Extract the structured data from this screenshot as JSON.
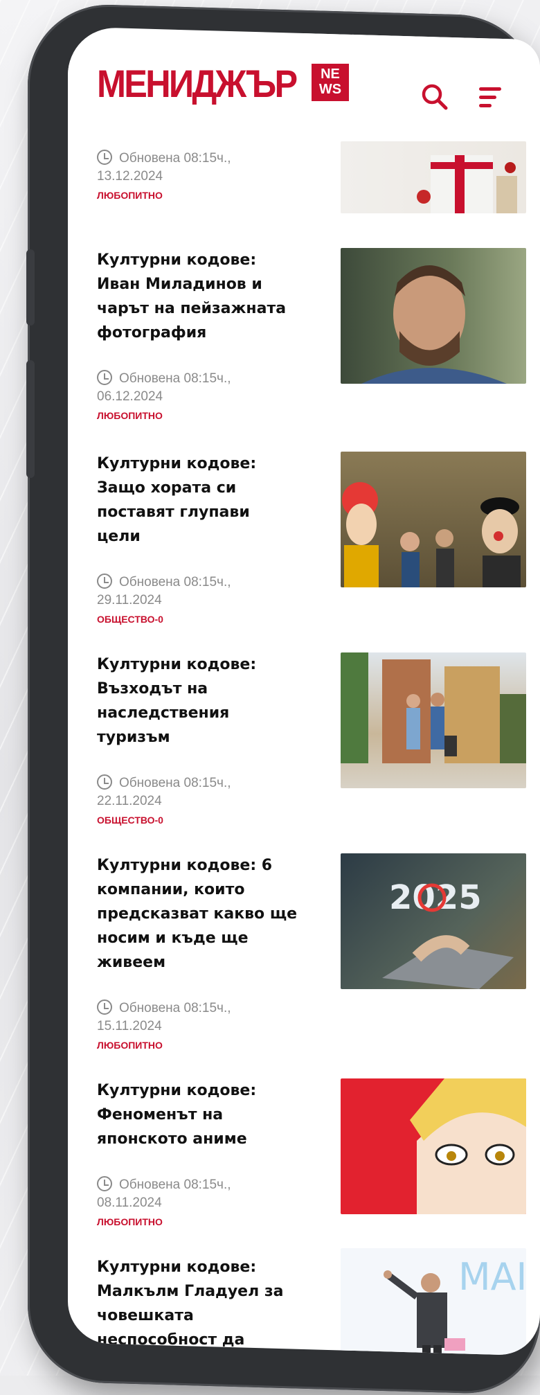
{
  "brand": {
    "logo_main": "МЕНИДЖЪР",
    "logo_badge_top": "NE",
    "logo_badge_bottom": "WS",
    "accent": "#c8102e"
  },
  "header": {
    "search_icon": "search-icon",
    "menu_icon": "hamburger-menu-icon"
  },
  "articles": [
    {
      "title": "",
      "updated": "Обновена 08:15ч.,",
      "date": "13.12.2024",
      "category": "ЛЮБОПИТНО"
    },
    {
      "title": "Културни кодове: Иван Миладинов и чарът на пейзажната фотография",
      "updated": "Обновена 08:15ч.,",
      "date": "06.12.2024",
      "category": "ЛЮБОПИТНО"
    },
    {
      "title": "Културни кодове: Защо хората си поставят глупави цели",
      "updated": "Обновена 08:15ч.,",
      "date": "29.11.2024",
      "category": "ОБЩЕСТВО-0"
    },
    {
      "title": "Културни кодове: Възходът на наследствения туризъм",
      "updated": "Обновена 08:15ч.,",
      "date": "22.11.2024",
      "category": "ОБЩЕСТВО-0"
    },
    {
      "title": "Културни кодове: 6 компании, които предсказват какво ще носим и къде ще живеем",
      "updated": "Обновена 08:15ч.,",
      "date": "15.11.2024",
      "category": "ЛЮБОПИТНО"
    },
    {
      "title": "Културни кодове: Феноменът на японското аниме",
      "updated": "Обновена 08:15ч.,",
      "date": "08.11.2024",
      "category": "ЛЮБОПИТНО"
    },
    {
      "title": "Културни кодове: Малкълм Гладуел за човешката неспособност да разпознаваме лъжите",
      "updated": "",
      "date": "",
      "category": ""
    }
  ],
  "thumb_2025_text": "2025",
  "thumb_anime_text": "MAI"
}
